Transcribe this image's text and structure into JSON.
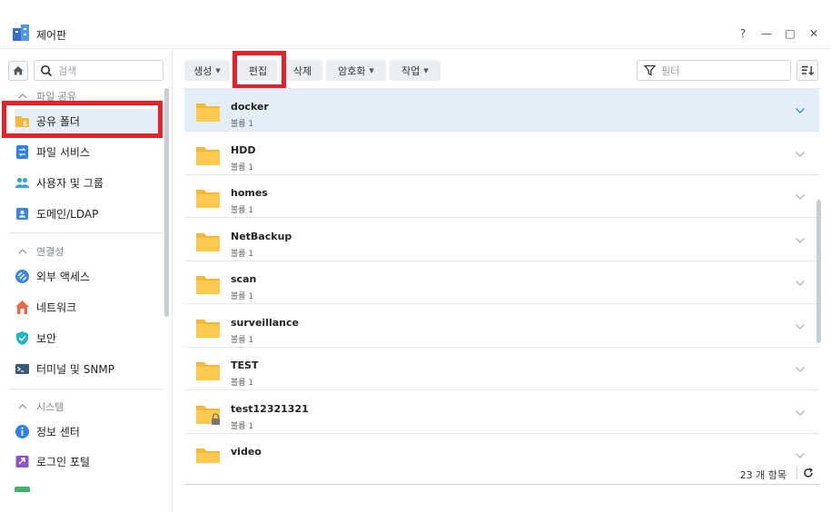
{
  "window": {
    "title": "제어판",
    "help": "?",
    "minimize": "—",
    "maximize": "□",
    "close": "✕"
  },
  "sidebar": {
    "search_placeholder": "검색",
    "sections": [
      {
        "label": "파일 공유",
        "items": [
          "공유 폴더",
          "파일 서비스",
          "사용자 및 그룹",
          "도메인/LDAP"
        ]
      },
      {
        "label": "연결성",
        "items": [
          "외부 액세스",
          "네트워크",
          "보안",
          "터미널 및 SNMP"
        ]
      },
      {
        "label": "시스템",
        "items": [
          "정보 센터",
          "로그인 포털"
        ]
      }
    ],
    "active_item": "공유 폴더"
  },
  "toolbar": {
    "create": "생성",
    "edit": "편집",
    "delete": "삭제",
    "encrypt": "암호화",
    "action": "작업",
    "filter_placeholder": "필터"
  },
  "folders": [
    {
      "name": "docker",
      "volume": "볼륨 1",
      "selected": true,
      "locked": false
    },
    {
      "name": "HDD",
      "volume": "볼륨 1",
      "selected": false,
      "locked": false
    },
    {
      "name": "homes",
      "volume": "볼륨 1",
      "selected": false,
      "locked": false
    },
    {
      "name": "NetBackup",
      "volume": "볼륨 1",
      "selected": false,
      "locked": false
    },
    {
      "name": "scan",
      "volume": "볼륨 1",
      "selected": false,
      "locked": false
    },
    {
      "name": "surveillance",
      "volume": "볼륨 1",
      "selected": false,
      "locked": false
    },
    {
      "name": "TEST",
      "volume": "볼륨 1",
      "selected": false,
      "locked": false
    },
    {
      "name": "test12321321",
      "volume": "볼륨 1",
      "selected": false,
      "locked": true
    },
    {
      "name": "video",
      "volume": "",
      "selected": false,
      "locked": false
    }
  ],
  "footer": {
    "count": "23 개 항목"
  },
  "colors": {
    "accent": "#3a8ee6",
    "selected_bg": "#e3eef9",
    "folder": "#f5b93a",
    "highlight": "#e8202a"
  }
}
